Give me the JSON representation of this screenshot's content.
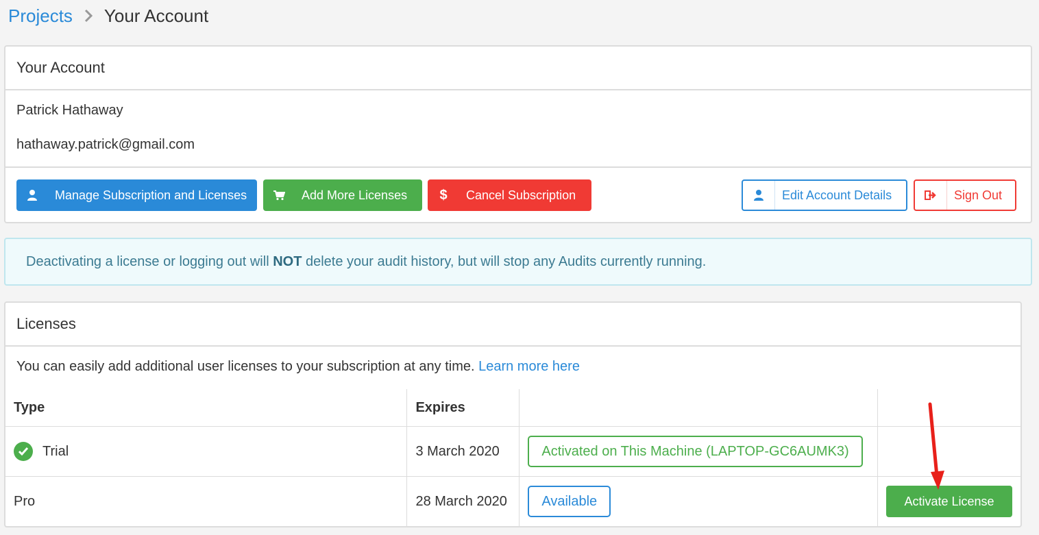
{
  "breadcrumb": {
    "root": "Projects",
    "current": "Your Account"
  },
  "account": {
    "title": "Your Account",
    "name": "Patrick Hathaway",
    "email": "hathaway.patrick@gmail.com",
    "buttons": {
      "manage": "Manage Subscription and Licenses",
      "add": "Add More Licenses",
      "cancel": "Cancel Subscription",
      "edit": "Edit Account Details",
      "signout": "Sign Out"
    }
  },
  "notice": {
    "before": "Deactivating a license or logging out will ",
    "bold": "NOT",
    "after": " delete your audit history, but will stop any Audits currently running."
  },
  "licenses": {
    "title": "Licenses",
    "description": "You can easily add additional user licenses to your subscription at any time. ",
    "learn_more": "Learn more here",
    "columns": [
      "Type",
      "Expires",
      "",
      ""
    ],
    "rows": [
      {
        "type": "Trial",
        "expires": "3 March 2020",
        "status": "Activated on This Machine (LAPTOP-GC6AUMK3)",
        "action": ""
      },
      {
        "type": "Pro",
        "expires": "28 March 2020",
        "status": "Available",
        "action": "Activate License"
      }
    ]
  },
  "colors": {
    "primary": "#2a8ad8",
    "success": "#4cae4c",
    "danger": "#f03a34",
    "info_bg": "#effafc"
  },
  "icons": [
    "chevron-right-icon",
    "user-icon",
    "cart-icon",
    "dollar-icon",
    "sign-out-icon",
    "check-circle-icon",
    "red-arrow-annotation"
  ]
}
